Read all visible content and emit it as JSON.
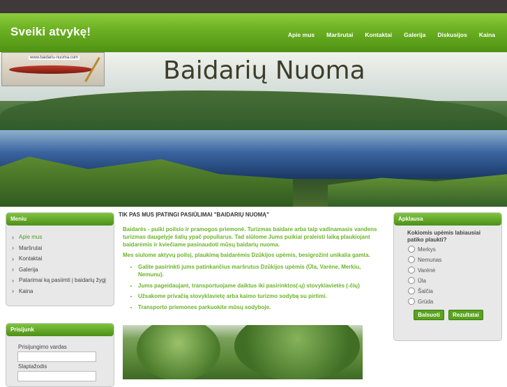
{
  "header": {
    "title": "Sveiki atvykę!",
    "nav": [
      "Apie mus",
      "Maršrutai",
      "Kontaktai",
      "Galerija",
      "Diskusijos",
      "Kaina"
    ]
  },
  "banner": {
    "title": "Baidarių Nuoma",
    "logo_url": "www.baidariu-nuoma.com"
  },
  "menu": {
    "title": "Meniu",
    "items": [
      "Apie mus",
      "Maršrutai",
      "Kontaktai",
      "Galerija",
      "Patarimai ką pasiimti į baidarių žygį",
      "Kaina"
    ]
  },
  "login": {
    "title": "Prisijunk",
    "username_label": "Prisijungimo vardas",
    "password_label": "Slaptažodis"
  },
  "content": {
    "title": "TIK PAS MUS ĮPATINGI PASIŪLIMAI \"BAIDARIŲ NUOMĄ\"",
    "paragraph1": "Baidarės - puiki poilsio ir pramogos priemonė. Turizmas baidare arba taip vadinamasis vandens turizmas daugelyje šalių ypač populiarus. Tad siūlome Jums puikiai praleisti laiką plaukiojant baidarėmis ir kviečiame pasinaudoti mūsų baidarių nuoma.",
    "paragraph2": "Mes siulome aktyvų poilsį, plaukimą baidarėmis Dzūkijos upėmis, besigrožint unikalia gamta.",
    "bullets": [
      "Galite pasirinkti jums patinkančius maršrutus Dzūkijos upėmis (Ūla, Varėne, Merkiu, Nemunu).",
      "Jums pageidaujant, transportuojame daiktus iki pasirinktos(-ų) stovyklavietės (-čių)",
      "Užsakome privačią stovyklavietę arba kaimo turizmo sodybą su pirtimi.",
      "Transporto priemones parkuokite mūsų sodyboje."
    ]
  },
  "poll": {
    "title": "Apklausa",
    "question": "Kokiomis upėmis labiausiai patiko plaukti?",
    "options": [
      "Merkys",
      "Nemunas",
      "Varėnė",
      "Ūla",
      "Šalčia",
      "Grūda"
    ],
    "vote_label": "Balsuoti",
    "results_label": "Rezultatai"
  },
  "colors": {
    "accent": "#6ab427",
    "header": "#5fa21c",
    "topbar": "#3f3a39"
  }
}
